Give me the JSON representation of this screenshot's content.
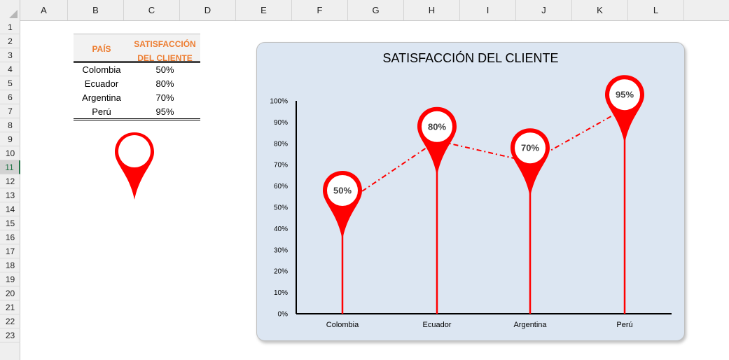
{
  "spreadsheet": {
    "columns": [
      "A",
      "B",
      "C",
      "D",
      "E",
      "F",
      "G",
      "H",
      "I",
      "J",
      "K",
      "L"
    ],
    "rows": [
      "1",
      "2",
      "3",
      "4",
      "5",
      "6",
      "7",
      "8",
      "9",
      "10",
      "11",
      "12",
      "13",
      "14",
      "15",
      "16",
      "17",
      "18",
      "19",
      "20",
      "21",
      "22",
      "23"
    ],
    "selected_row": "11"
  },
  "table": {
    "header_country": "PAÍS",
    "header_satisfaction_line1": "SATISFACCIÓN",
    "header_satisfaction_line2": "DEL CLIENTE",
    "rows": [
      {
        "country": "Colombia",
        "value": "50%"
      },
      {
        "country": "Ecuador",
        "value": "80%"
      },
      {
        "country": "Argentina",
        "value": "70%"
      },
      {
        "country": "Perú",
        "value": "95%"
      }
    ]
  },
  "colors": {
    "accent_red": "#ff0000",
    "header_orange": "#ed7d31",
    "chart_bg": "#dce6f2"
  },
  "chart_data": {
    "type": "line",
    "title": "SATISFACCIÓN DEL CLIENTE",
    "categories": [
      "Colombia",
      "Ecuador",
      "Argentina",
      "Perú"
    ],
    "values": [
      50,
      80,
      70,
      95
    ],
    "data_labels": [
      "50%",
      "80%",
      "70%",
      "95%"
    ],
    "ylim": [
      0,
      100
    ],
    "y_ticks": [
      "0%",
      "10%",
      "20%",
      "30%",
      "40%",
      "50%",
      "60%",
      "70%",
      "80%",
      "90%",
      "100%"
    ],
    "grid": false,
    "legend": "none",
    "line_style": "dash-dot",
    "marker": "map-pin"
  }
}
